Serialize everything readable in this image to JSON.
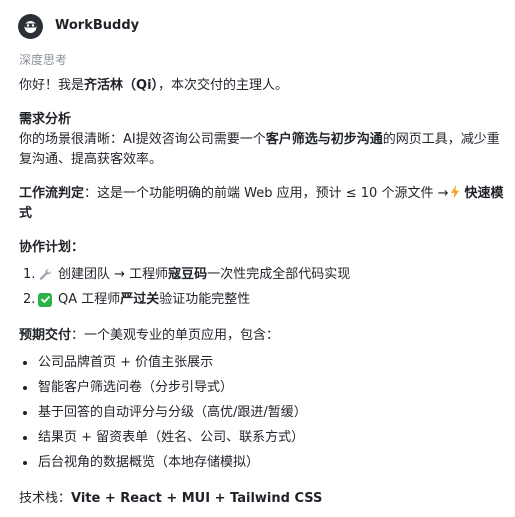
{
  "app": {
    "name": "WorkBuddy",
    "status": "深度思考"
  },
  "message": {
    "greeting": {
      "pre": "你好！我是",
      "name": "齐活林（Qi）",
      "post": "，本次交付的主理人。"
    },
    "needs": {
      "heading": "需求分析",
      "pre": "你的场景很清晰：AI提效咨询公司需要一个",
      "strong": "客户筛选与初步沟通",
      "post": "的网页工具，减少重复沟通、提高获客效率。"
    },
    "workflow": {
      "label": "工作流判定",
      "text": "：这是一个功能明确的前端 Web 应用，预计 ≤ 10 个源文件 →",
      "mode": "快速模式"
    },
    "plan": {
      "heading": "协作计划",
      "steps": [
        {
          "num": "1.",
          "pre": "创建团队 → 工程师",
          "strong": "寇豆码",
          "post": "一次性完成全部代码实现",
          "icon": "wrench-icon"
        },
        {
          "num": "2.",
          "pre": "QA 工程师",
          "strong": "严过关",
          "post": "验证功能完整性",
          "icon": "checkmark-icon"
        }
      ]
    },
    "delivery": {
      "label": "预期交付",
      "text": "：一个美观专业的单页应用，包含：",
      "items": [
        "公司品牌首页 + 价值主张展示",
        "智能客户筛选问卷（分步引导式）",
        "基于回答的自动评分与分级（高优/跟进/暂缓）",
        "结果页 + 留资表单（姓名、公司、联系方式）",
        "后台视角的数据概览（本地存储模拟）"
      ]
    },
    "stack": {
      "label": "技术栈：",
      "value": "Vite + React + MUI + Tailwind CSS"
    }
  },
  "colors": {
    "text": "#1f2329",
    "muted": "#8a8f99",
    "check": "#2fb24a",
    "bolt": "#f5a623"
  }
}
